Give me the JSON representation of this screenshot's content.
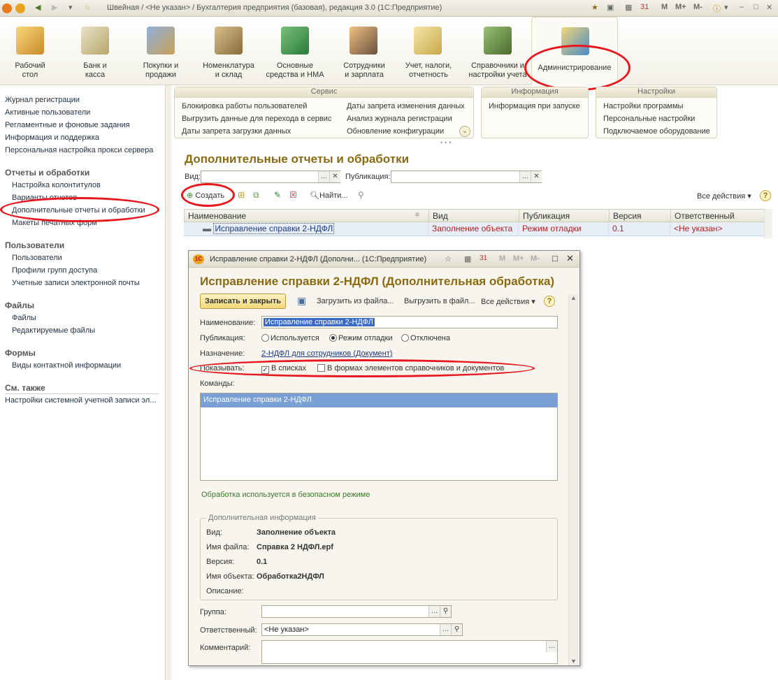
{
  "window": {
    "title": "Швейная / <Не указан> / Бухгалтерия предприятия (базовая), редакция 3.0  (1С:Предприятие)",
    "btn_m": "M",
    "btn_mplus": "M+",
    "btn_mminus": "M-"
  },
  "sections": [
    {
      "label": "Рабочий\nстол"
    },
    {
      "label": "Банк и\nкасса"
    },
    {
      "label": "Покупки и\nпродажи"
    },
    {
      "label": "Номенклатура\nи склад"
    },
    {
      "label": "Основные\nсредства и НМА"
    },
    {
      "label": "Сотрудники\nи зарплата"
    },
    {
      "label": "Учет, налоги,\nотчетность"
    },
    {
      "label": "Справочники и\nнастройки учета"
    },
    {
      "label": "Администрирование"
    }
  ],
  "leftnav": {
    "top": [
      "Журнал регистрации",
      "Активные пользователи",
      "Регламентные и фоновые задания",
      "Информация и поддержка",
      "Персональная настройка прокси сервера"
    ],
    "groups": [
      {
        "title": "Отчеты и обработки",
        "items": [
          "Настройка колонтитулов",
          "Варианты отчетов",
          "Дополнительные отчеты и обработки",
          "Макеты печатных форм"
        ]
      },
      {
        "title": "Пользователи",
        "items": [
          "Пользователи",
          "Профили групп доступа",
          "Учетные записи электронной почты"
        ]
      },
      {
        "title": "Файлы",
        "items": [
          "Файлы",
          "Редактируемые файлы"
        ]
      },
      {
        "title": "Формы",
        "items": [
          "Виды контактной информации"
        ]
      }
    ],
    "see_also_title": "См. также",
    "see_also": [
      "Настройки системной учетной записи эл..."
    ]
  },
  "panels": {
    "service": {
      "title": "Сервис",
      "col1": [
        "Блокировка работы пользователей",
        "Выгрузить данные для перехода в сервис",
        "Даты запрета загрузки данных"
      ],
      "col2": [
        "Даты запрета изменения данных",
        "Анализ журнала регистрации",
        "Обновление конфигурации"
      ]
    },
    "info": {
      "title": "Информация",
      "items": [
        "Информация при запуске"
      ]
    },
    "settings": {
      "title": "Настройки",
      "items": [
        "Настройки программы",
        "Персональные настройки",
        "Подключаемое оборудование"
      ]
    }
  },
  "page": {
    "title": "Дополнительные отчеты и обработки",
    "filter_kind_label": "Вид:",
    "filter_pub_label": "Публикация:",
    "create_btn": "Создать",
    "find_btn": "Найти...",
    "all_actions": "Все действия",
    "columns": [
      "Наименование",
      "Вид",
      "Публикация",
      "Версия",
      "Ответственный"
    ],
    "rows": [
      {
        "name": "Исправление справки 2-НДФЛ",
        "kind": "Заполнение объекта",
        "publication": "Режим отладки",
        "version": "0.1",
        "responsible": "<Не указан>"
      }
    ]
  },
  "dialog": {
    "window_title": "Исправление справки 2-НДФЛ (Дополни...  (1С:Предприятие)",
    "header": "Исправление справки 2-НДФЛ (Дополнительная обработка)",
    "save_close": "Записать и закрыть",
    "load_file": "Загрузить из файла...",
    "unload_file": "Выгрузить в файл...",
    "all_actions": "Все действия",
    "name_label": "Наименование:",
    "name_value": "Исправление справки 2-НДФЛ",
    "pub_label": "Публикация:",
    "pub_options": [
      "Используется",
      "Режим отладки",
      "Отключена"
    ],
    "purpose_label": "Назначение:",
    "purpose_value": "2-НДФЛ для сотрудников (Документ)",
    "show_label": "Показывать:",
    "show_in_lists": "В списках",
    "show_in_forms": "В формах элементов справочников и документов",
    "commands_label": "Команды:",
    "commands": [
      "Исправление справки 2-НДФЛ"
    ],
    "safe_mode_note": "Обработка используется в безопасном режиме",
    "extra_title": "Дополнительная информация",
    "extra": [
      {
        "label": "Вид:",
        "value": "Заполнение объекта"
      },
      {
        "label": "Имя файла:",
        "value": "Справка 2 НДФЛ.epf"
      },
      {
        "label": "Версия:",
        "value": "0.1"
      },
      {
        "label": "Имя объекта:",
        "value": "Обработка2НДФЛ"
      },
      {
        "label": "Описание:",
        "value": ""
      }
    ],
    "group_label": "Группа:",
    "responsible_label": "Ответственный:",
    "responsible_value": "<Не указан>",
    "comment_label": "Комментарий:"
  },
  "colors": {
    "accent": "#8a6a10",
    "highlight_red": "#e8171d",
    "selection": "#7a9fd4"
  }
}
